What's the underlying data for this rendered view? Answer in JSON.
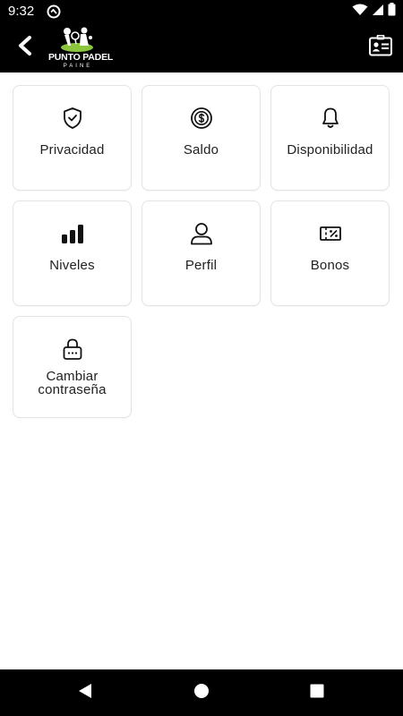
{
  "status_bar": {
    "time": "9:32"
  },
  "app_bar": {
    "logo": {
      "title": "PUNTO PADEL",
      "subtitle": "PAINE"
    },
    "back_icon": "chevron-left-icon",
    "right_icon": "id-card-icon"
  },
  "menu": {
    "items": [
      {
        "label": "Privacidad",
        "icon": "shield-check-icon"
      },
      {
        "label": "Saldo",
        "icon": "dollar-coin-icon"
      },
      {
        "label": "Disponibilidad",
        "icon": "bell-icon"
      },
      {
        "label": "Niveles",
        "icon": "bar-chart-icon"
      },
      {
        "label": "Perfil",
        "icon": "user-icon"
      },
      {
        "label": "Bonos",
        "icon": "ticket-percent-icon"
      },
      {
        "label": "Cambiar\ncontraseña",
        "icon": "lock-icon"
      }
    ]
  },
  "nav_bar": {
    "back": "triangle-back-icon",
    "home": "circle-home-icon",
    "recents": "square-recents-icon"
  },
  "colors": {
    "bar_background": "#000000",
    "page_background": "#ffffff",
    "tile_border": "#e3e3e3",
    "text": "#222222"
  }
}
